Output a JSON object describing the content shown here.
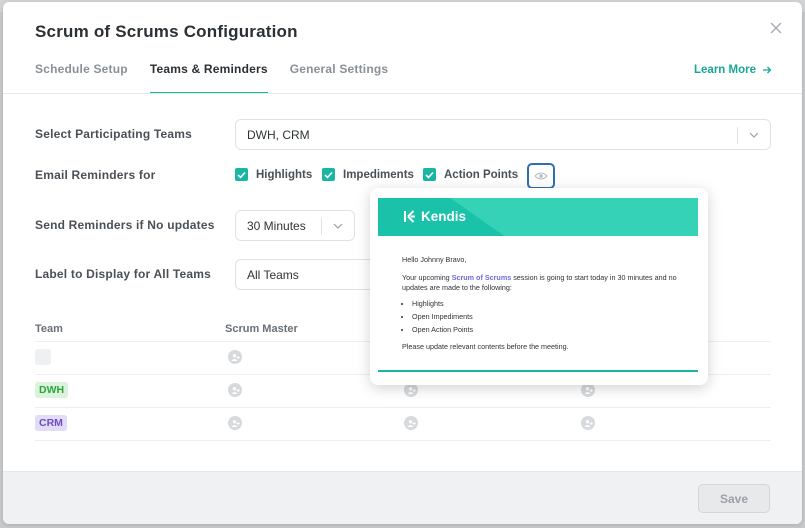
{
  "dialog": {
    "title": "Scrum of Scrums Configuration",
    "learn_more": "Learn More"
  },
  "tabs": [
    {
      "label": "Schedule Setup",
      "active": false
    },
    {
      "label": "Teams & Reminders",
      "active": true
    },
    {
      "label": "General Settings",
      "active": false
    }
  ],
  "form": {
    "participating_teams": {
      "label": "Select Participating Teams",
      "value": "DWH, CRM"
    },
    "email_reminders": {
      "label": "Email Reminders for",
      "options": [
        {
          "label": "Highlights",
          "checked": true
        },
        {
          "label": "Impediments",
          "checked": true
        },
        {
          "label": "Action Points",
          "checked": true
        }
      ]
    },
    "send_reminders": {
      "label": "Send Reminders if No updates",
      "value": "30 Minutes"
    },
    "display_label": {
      "label": "Label to Display for All Teams",
      "value": "All Teams"
    }
  },
  "table": {
    "headers": [
      "Team",
      "Scrum Master"
    ],
    "rows": [
      {
        "team": ""
      },
      {
        "team": "DWH"
      },
      {
        "team": "CRM"
      }
    ]
  },
  "preview": {
    "logo": "Kendis",
    "greeting": "Hello Johnny Bravo,",
    "line_pre": "Your upcoming ",
    "highlight": "Scrum of Scrums",
    "line_post": " session is going to start today in 30 minutes and no updates are made to the following:",
    "items": [
      "Highlights",
      "Open Impediments",
      "Open Action Points"
    ],
    "closing": "Please update relevant contents before the meeting."
  },
  "footer": {
    "save_label": "Save"
  },
  "colors": {
    "accent": "#19b6a3",
    "focus": "#2f6fb0",
    "dwh": "#30a53d",
    "crm": "#6a4fbd"
  }
}
